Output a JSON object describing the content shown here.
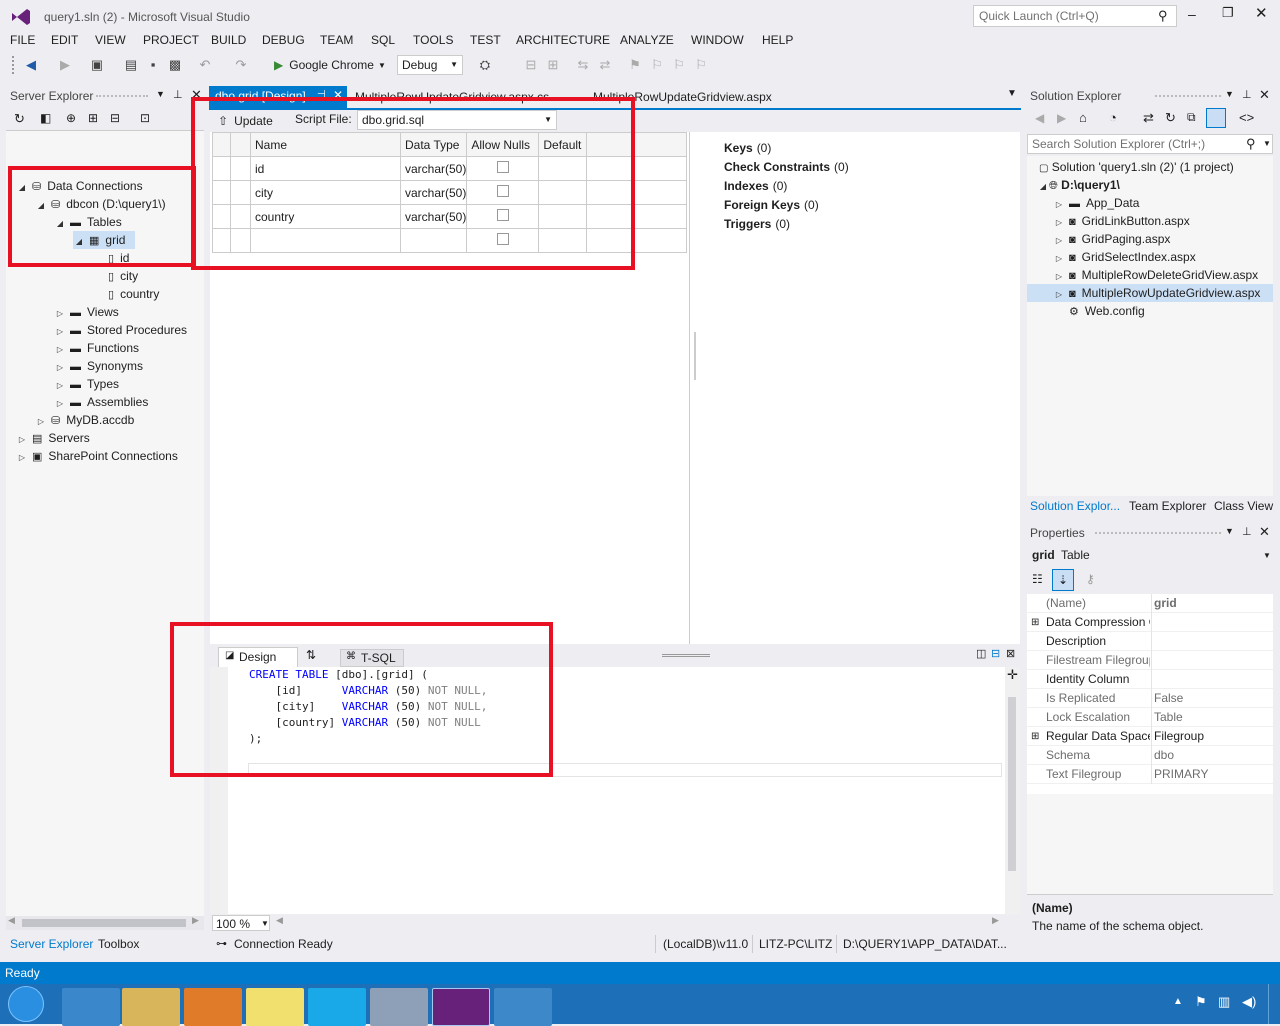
{
  "window": {
    "title": "query1.sln (2) - Microsoft Visual Studio",
    "quick_launch_placeholder": "Quick Launch (Ctrl+Q)"
  },
  "menu": [
    "FILE",
    "EDIT",
    "VIEW",
    "PROJECT",
    "BUILD",
    "DEBUG",
    "TEAM",
    "SQL",
    "TOOLS",
    "TEST",
    "ARCHITECTURE",
    "ANALYZE",
    "WINDOW",
    "HELP"
  ],
  "toolbar": {
    "run_target": "Google Chrome",
    "config": "Debug"
  },
  "server_explorer": {
    "title": "Server Explorer",
    "tree": [
      {
        "label": "Data Connections",
        "level": 1,
        "icon": "data-connections-icon",
        "exp": "open"
      },
      {
        "label": "dbcon (D:\\query1\\)",
        "level": 2,
        "icon": "database-icon",
        "exp": "open"
      },
      {
        "label": "Tables",
        "level": 3,
        "icon": "folder-icon",
        "exp": "open"
      },
      {
        "label": "grid",
        "level": 4,
        "icon": "table-icon",
        "exp": "open",
        "selected": true
      },
      {
        "label": "id",
        "level": 5,
        "icon": "column-icon",
        "exp": ""
      },
      {
        "label": "city",
        "level": 5,
        "icon": "column-icon",
        "exp": ""
      },
      {
        "label": "country",
        "level": 5,
        "icon": "column-icon",
        "exp": ""
      },
      {
        "label": "Views",
        "level": 3,
        "icon": "folder-icon",
        "exp": "closed"
      },
      {
        "label": "Stored Procedures",
        "level": 3,
        "icon": "folder-icon",
        "exp": "closed"
      },
      {
        "label": "Functions",
        "level": 3,
        "icon": "folder-icon",
        "exp": "closed"
      },
      {
        "label": "Synonyms",
        "level": 3,
        "icon": "folder-icon",
        "exp": "closed"
      },
      {
        "label": "Types",
        "level": 3,
        "icon": "folder-icon",
        "exp": "closed"
      },
      {
        "label": "Assemblies",
        "level": 3,
        "icon": "folder-icon",
        "exp": "closed"
      },
      {
        "label": "MyDB.accdb",
        "level": 2,
        "icon": "access-db-icon",
        "exp": "closed"
      },
      {
        "label": "Servers",
        "level": 1,
        "icon": "servers-icon",
        "exp": "closed"
      },
      {
        "label": "SharePoint Connections",
        "level": 1,
        "icon": "sharepoint-icon",
        "exp": "closed"
      }
    ],
    "bottom_tabs": [
      "Server Explorer",
      "Toolbox"
    ]
  },
  "doc_tabs": [
    "dbo.grid [Design]",
    "MultipleRowUpdateGridview.aspx.cs",
    "MultipleRowUpdateGridview.aspx"
  ],
  "designer": {
    "update_label": "Update",
    "script_file_label": "Script File:",
    "script_file_value": "dbo.grid.sql",
    "columns_header": [
      "Name",
      "Data Type",
      "Allow Nulls",
      "Default"
    ],
    "rows": [
      {
        "name": "id",
        "type": "varchar(50)"
      },
      {
        "name": "city",
        "type": "varchar(50)"
      },
      {
        "name": "country",
        "type": "varchar(50)"
      }
    ],
    "side": [
      {
        "label": "Keys",
        "count": "(0)"
      },
      {
        "label": "Check Constraints",
        "count": "(0)"
      },
      {
        "label": "Indexes",
        "count": "(0)"
      },
      {
        "label": "Foreign Keys",
        "count": "(0)"
      },
      {
        "label": "Triggers",
        "count": "(0)"
      }
    ],
    "pane_tabs": {
      "design": "Design",
      "swap": "⇅",
      "tsql": "T-SQL"
    },
    "sql": {
      "l1a": "CREATE TABLE",
      "l1b": " [dbo].[grid] (",
      "l2a": "    [id]      ",
      "l2b": "VARCHAR",
      "l2c": " (50) ",
      "l2d": "NOT NULL,",
      "l3a": "    [city]    ",
      "l3b": "VARCHAR",
      "l3c": " (50) ",
      "l3d": "NOT NULL,",
      "l4a": "    [country] ",
      "l4b": "VARCHAR",
      "l4c": " (50) ",
      "l4d": "NOT NULL",
      "l5": ");"
    },
    "zoom": "100 %"
  },
  "status_strip": {
    "connection": "Connection Ready",
    "server": "(LocalDB)\\v11.0",
    "user": "LITZ-PC\\LITZ",
    "path": "D:\\QUERY1\\APP_DATA\\DAT..."
  },
  "solution_explorer": {
    "title": "Solution Explorer",
    "search_placeholder": "Search Solution Explorer (Ctrl+;)",
    "solution": "Solution 'query1.sln (2)' (1 project)",
    "project": "D:\\query1\\",
    "items": [
      "App_Data",
      "GridLinkButton.aspx",
      "GridPaging.aspx",
      "GridSelectIndex.aspx",
      "MultipleRowDeleteGridView.aspx",
      "MultipleRowUpdateGridview.aspx",
      "Web.config"
    ],
    "bottom_tabs": [
      "Solution Explor...",
      "Team Explorer",
      "Class View"
    ]
  },
  "properties": {
    "title": "Properties",
    "object_name": "grid",
    "object_type": "Table",
    "rows": [
      {
        "k": "(Name)",
        "v": "grid",
        "bold": true,
        "dim": true
      },
      {
        "k": "Data Compression O",
        "v": "",
        "plus": true
      },
      {
        "k": "Description",
        "v": ""
      },
      {
        "k": "Filestream Filegroup",
        "v": "",
        "dim": true
      },
      {
        "k": "Identity Column",
        "v": ""
      },
      {
        "k": "Is Replicated",
        "v": "False",
        "dim": true
      },
      {
        "k": "Lock Escalation",
        "v": "Table",
        "dim": true
      },
      {
        "k": "Regular Data Space",
        "v": "Filegroup",
        "plus": true
      },
      {
        "k": "Schema",
        "v": "dbo",
        "dim": true
      },
      {
        "k": "Text Filegroup",
        "v": "PRIMARY",
        "dim": true
      }
    ],
    "desc_title": "(Name)",
    "desc_text": "The name of the schema object."
  },
  "statusbar": {
    "text": "Ready"
  },
  "colors": {
    "accent": "#007acc",
    "highlight": "#e81123"
  }
}
